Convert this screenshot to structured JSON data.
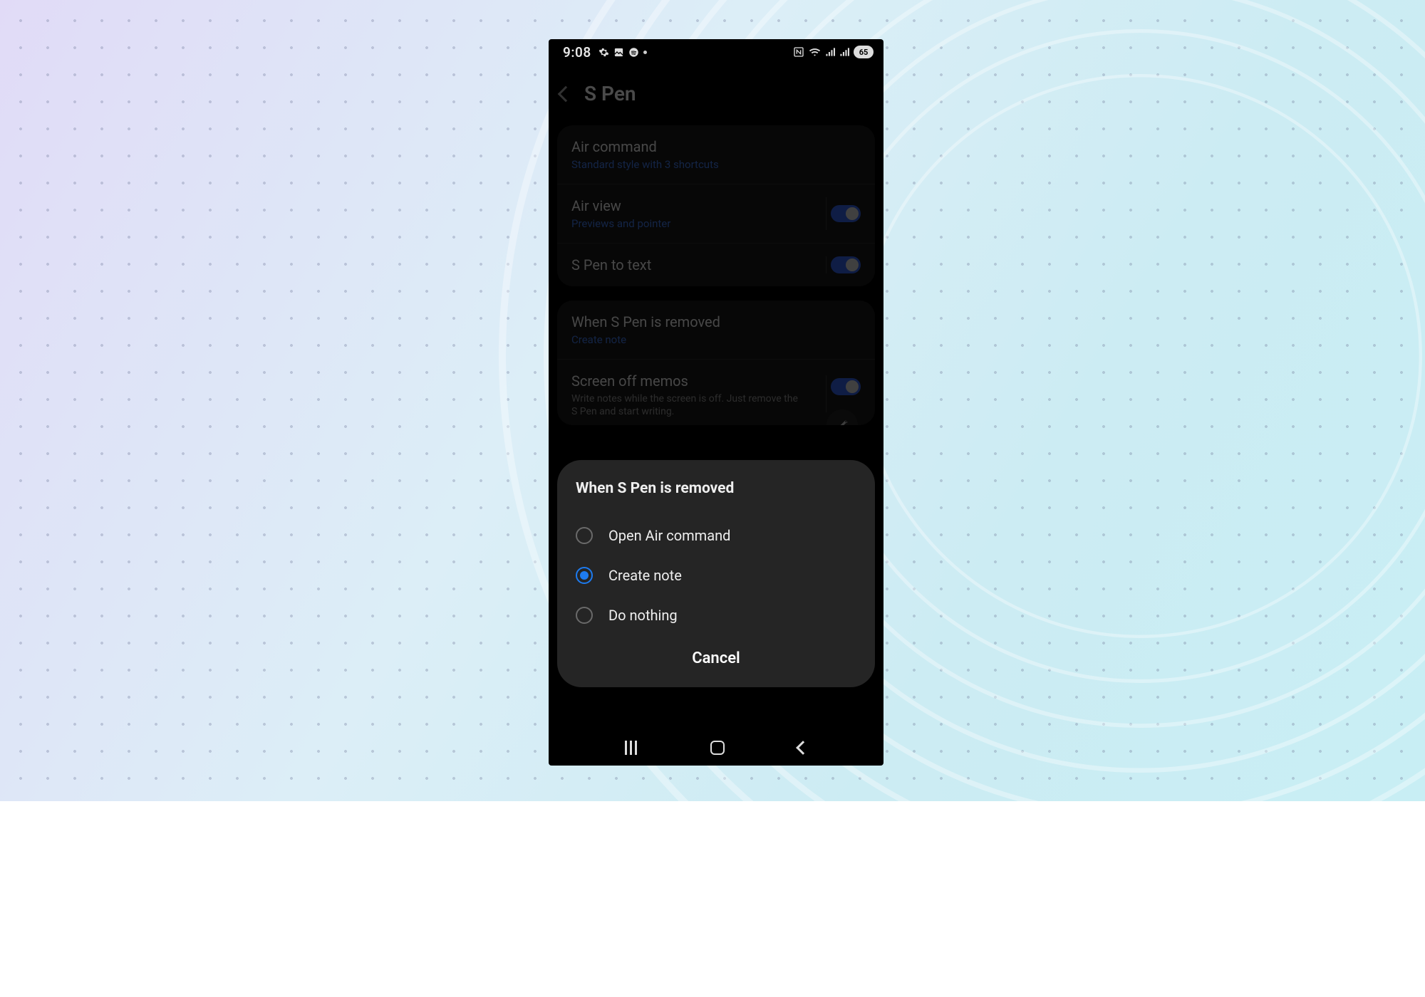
{
  "status": {
    "time": "9:08",
    "battery": "65"
  },
  "header": {
    "title": "S Pen"
  },
  "group1": {
    "air_command_label": "Air command",
    "air_command_sub": "Standard style with 3 shortcuts",
    "air_view_label": "Air view",
    "air_view_sub": "Previews and pointer",
    "spen_text_label": "S Pen to text"
  },
  "group2": {
    "removed_label": "When S Pen is removed",
    "removed_sub": "Create note",
    "memos_label": "Screen off memos",
    "memos_sub": "Write notes while the screen is off. Just remove the S Pen and start writing."
  },
  "sheet": {
    "title": "When S Pen is removed",
    "opt1": "Open Air command",
    "opt2": "Create note",
    "opt3": "Do nothing",
    "cancel": "Cancel",
    "selected_index": 1
  }
}
